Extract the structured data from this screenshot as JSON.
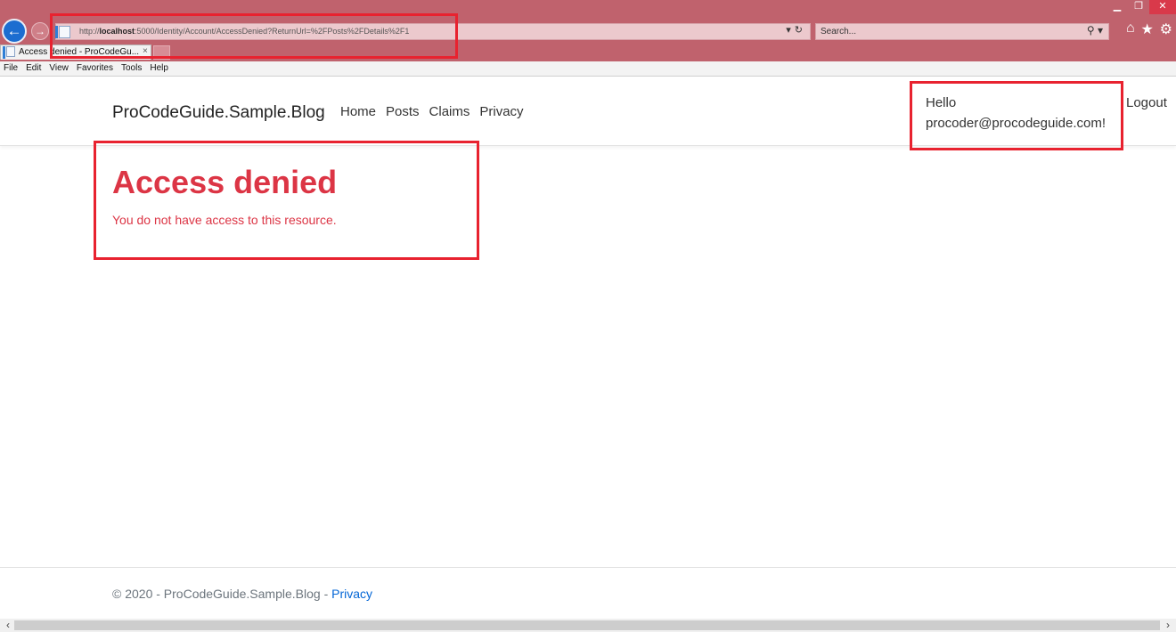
{
  "browser": {
    "address_url_prefix": "http://",
    "address_url_host": "localhost",
    "address_url_rest": ":5000/Identity/Account/AccessDenied?ReturnUrl=%2FPosts%2FDetails%2F1",
    "search_placeholder": "Search...",
    "tab_title": "Access denied - ProCodeGu...",
    "tab_close": "×",
    "menu": [
      "File",
      "Edit",
      "View",
      "Favorites",
      "Tools",
      "Help"
    ],
    "icons": [
      "back-arrow-icon",
      "forward-arrow-icon",
      "refresh-icon",
      "search-icon",
      "home-icon",
      "favorites-star-icon",
      "settings-gear-icon"
    ]
  },
  "site": {
    "brand": "ProCodeGuide.Sample.Blog",
    "nav": [
      "Home",
      "Posts",
      "Claims",
      "Privacy"
    ],
    "greeting_line1": "Hello",
    "greeting_line2": "procoder@procodeguide.com!",
    "logout": "Logout"
  },
  "main": {
    "title": "Access denied",
    "message": "You do not have access to this resource."
  },
  "footer": {
    "text": "© 2020 - ProCodeGuide.Sample.Blog - ",
    "privacy_link": "Privacy"
  },
  "colors": {
    "chrome": "#c0626d",
    "danger": "#dc3545",
    "link": "#0366d6",
    "callout": "#e8222f"
  }
}
